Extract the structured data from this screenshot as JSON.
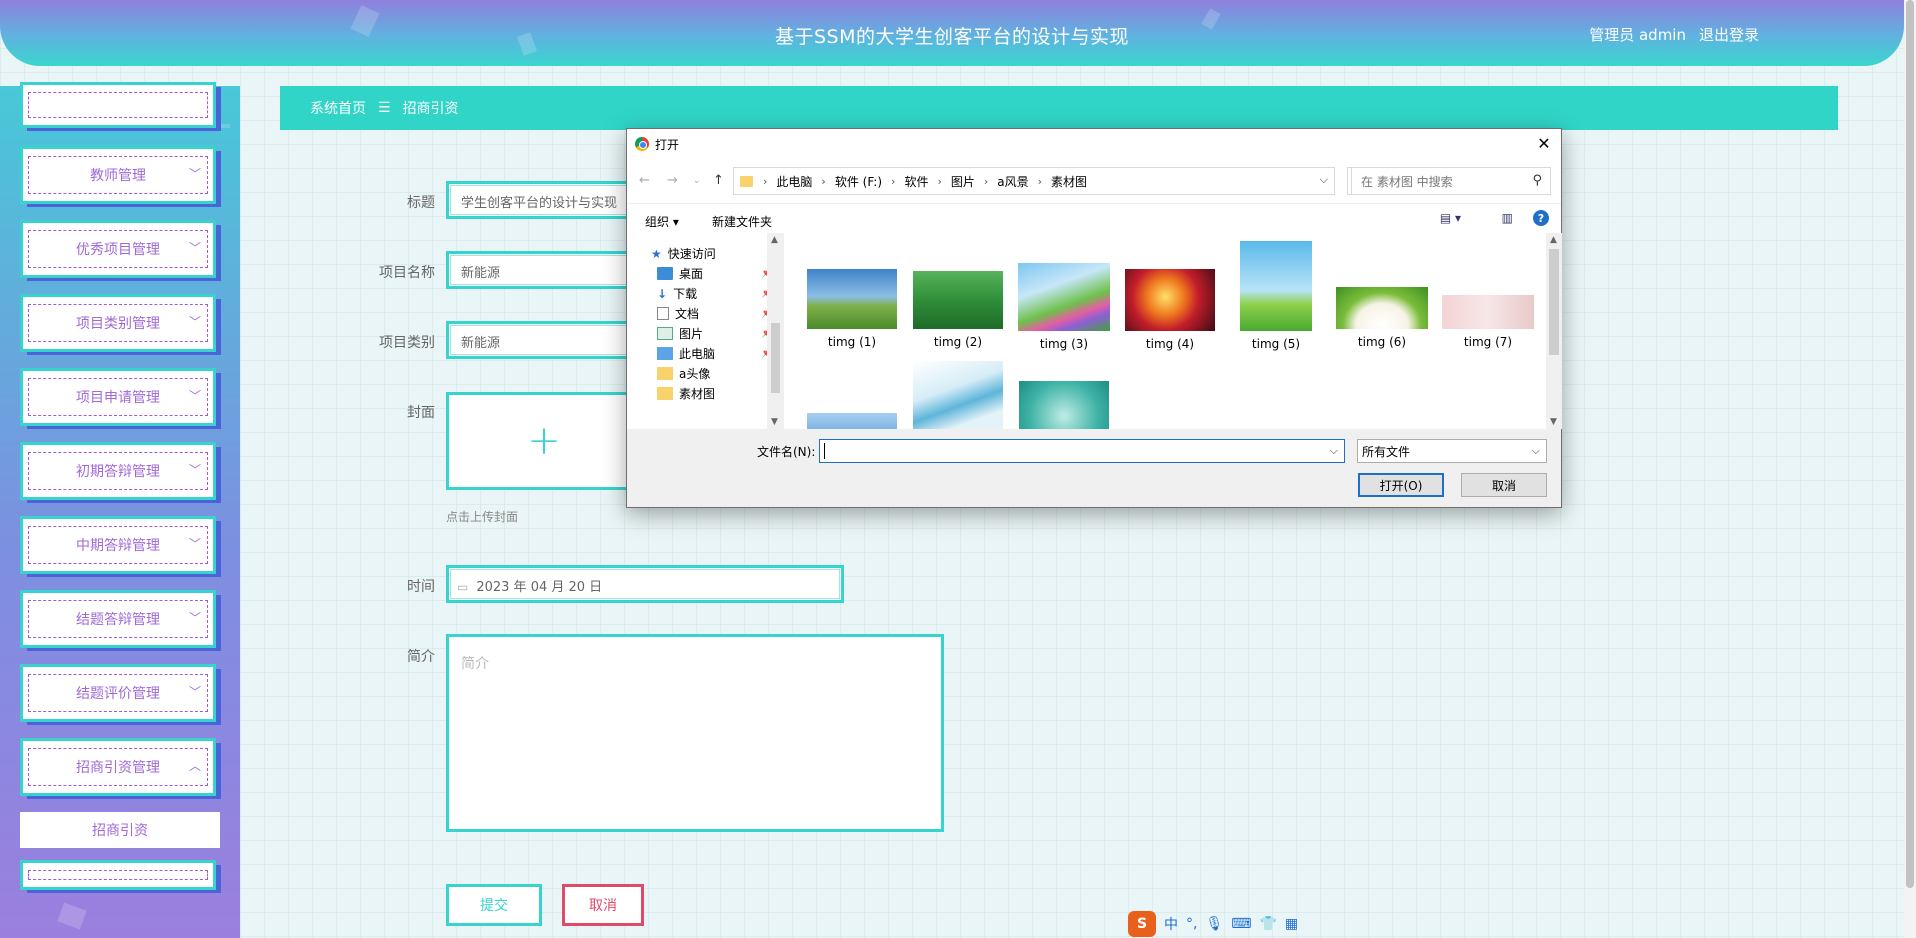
{
  "header": {
    "title": "基于SSM的大学生创客平台的设计与实现",
    "user": "管理员 admin",
    "logout": "退出登录"
  },
  "sidebar": {
    "items": [
      {
        "label": "教师管理"
      },
      {
        "label": "优秀项目管理"
      },
      {
        "label": "项目类别管理"
      },
      {
        "label": "项目申请管理"
      },
      {
        "label": "初期答辩管理"
      },
      {
        "label": "中期答辩管理"
      },
      {
        "label": "结题答辩管理"
      },
      {
        "label": "结题评价管理"
      },
      {
        "label": "招商引资管理"
      }
    ],
    "active_sub": "招商引资"
  },
  "breadcrumb": {
    "home": "系统首页",
    "sep_icon": "menu-icon",
    "current": "招商引资"
  },
  "form": {
    "title_label": "标题",
    "title_value": "学生创客平台的设计与实现",
    "project_name_label": "项目名称",
    "project_name_value": "新能源",
    "project_type_label": "项目类别",
    "project_type_value": "新能源",
    "cover_label": "封面",
    "cover_hint": "点击上传封面",
    "time_label": "时间",
    "time_value": "2023 年 04 月 20 日",
    "intro_label": "简介",
    "intro_placeholder": "简介",
    "submit": "提交",
    "cancel": "取消"
  },
  "dialog": {
    "title": "打开",
    "path": [
      "此电脑",
      "软件 (F:)",
      "软件",
      "图片",
      "a风景",
      "素材图"
    ],
    "search_placeholder": "在 素材图 中搜索",
    "organize": "组织 ▾",
    "new_folder": "新建文件夹",
    "tree": [
      {
        "label": "快速访问",
        "icon": "star-icon",
        "pinned": false
      },
      {
        "label": "桌面",
        "icon": "desktop-icon",
        "pinned": true
      },
      {
        "label": "下载",
        "icon": "download-icon",
        "pinned": true
      },
      {
        "label": "文档",
        "icon": "document-icon",
        "pinned": true
      },
      {
        "label": "图片",
        "icon": "picture-icon",
        "pinned": true
      },
      {
        "label": "此电脑",
        "icon": "computer-icon",
        "pinned": true
      },
      {
        "label": "a头像",
        "icon": "folder-icon",
        "pinned": false
      },
      {
        "label": "素材图",
        "icon": "folder-icon",
        "pinned": false
      }
    ],
    "files": [
      {
        "name": "timg (1)"
      },
      {
        "name": "timg (2)"
      },
      {
        "name": "timg (3)"
      },
      {
        "name": "timg (4)"
      },
      {
        "name": "timg (5)"
      },
      {
        "name": "timg (6)"
      },
      {
        "name": "timg (7)"
      }
    ],
    "filename_label": "文件名(N):",
    "filename_value": "",
    "filetype": "所有文件",
    "open": "打开(O)",
    "cancel": "取消"
  },
  "ime": {
    "items": [
      "中",
      "°,"
    ]
  },
  "colors": {
    "accent": "#36d3cf",
    "sidebar_text": "#a06ad6",
    "cancel": "#e04b6a"
  }
}
